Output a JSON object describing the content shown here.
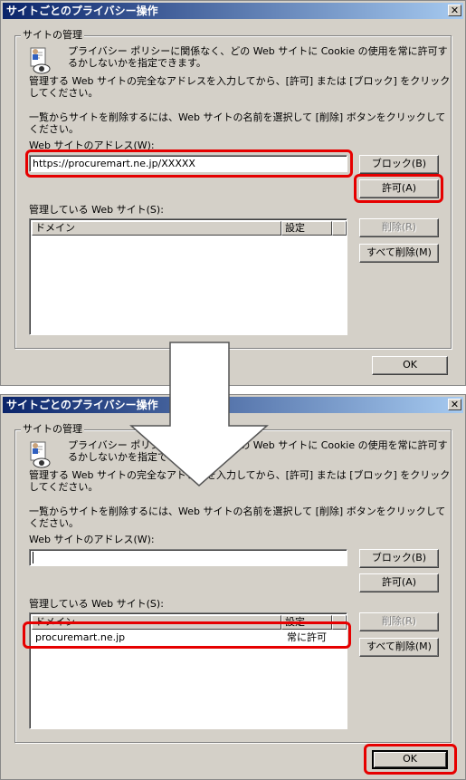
{
  "dialog_title": "サイトごとのプライバシー操作",
  "close_label": "✕",
  "group_label": "サイトの管理",
  "intro_text": "プライバシー ポリシーに関係なく、どの Web サイトに Cookie の使用を常に許可するかしないかを指定できます。",
  "instruction_text": "管理する Web サイトの完全なアドレスを入力してから、[許可] または [ブロック] をクリックしてください。",
  "remove_text": "一覧からサイトを削除するには、Web サイトの名前を選択して [削除] ボタンをクリックしてください。",
  "address_label": "Web サイトのアドレス(W):",
  "block_label": "ブロック(B)",
  "allow_label": "許可(A)",
  "managed_label": "管理している Web サイト(S):",
  "col_domain": "ドメイン",
  "col_setting": "設定",
  "delete_label": "削除(R)",
  "delete_all_label": "すべて削除(M)",
  "ok_label": "OK",
  "step1": {
    "address_value": "https://procuremart.ne.jp/XXXXX"
  },
  "step2": {
    "address_value": "",
    "rows": [
      {
        "domain": "procuremart.ne.jp",
        "setting": "常に許可"
      }
    ]
  },
  "colors": {
    "highlight": "#e60000",
    "dialog_bg": "#d4d0c8",
    "title_start": "#0a246a",
    "title_end": "#a6caf0"
  },
  "icons": [
    "privacy-shield-eye-icon",
    "close-icon",
    "down-arrow-icon"
  ]
}
